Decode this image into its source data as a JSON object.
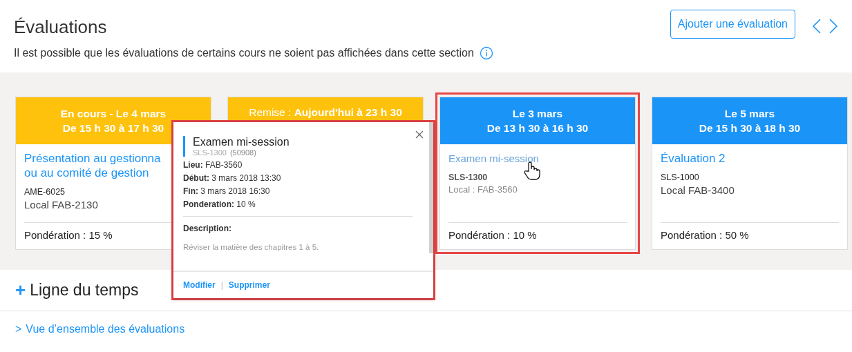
{
  "header": {
    "title": "Évaluations",
    "add_button": "Ajouter une évaluation",
    "note": "Il est possible que les évaluations de certains cours ne soient pas affichées dans cette section"
  },
  "cards": [
    {
      "color": "#fec20c",
      "header_lines": [
        "En cours - Le 4 mars",
        "De 15 h 30 à 17 h 30"
      ],
      "title_lines": [
        "Présentation au gestionna",
        "ou au comité de gestion"
      ],
      "course": "AME-6025",
      "room": "Local FAB-2130",
      "weight": "Pondération : 15 %",
      "highlighted": false,
      "hovered": false
    },
    {
      "color": "#fec20c",
      "header_lines": [
        "Remise : **Aujourd'hui à 23 h 30**"
      ],
      "highlighted": false
    },
    {
      "color": "#1b94f8",
      "header_lines": [
        "Le 3 mars",
        "De 13 h 30 à 16 h 30"
      ],
      "title_lines": [
        "Examen mi-session"
      ],
      "course": "SLS-1300",
      "room": "Local : FAB-3560",
      "weight": "Pondération : 10 %",
      "highlighted": true,
      "hovered": true
    },
    {
      "color": "#1b94f8",
      "header_lines": [
        "Le 5 mars",
        "De 15 h 30 à 18 h 30"
      ],
      "title_lines": [
        "Évaluation 2"
      ],
      "course": "SLS-1000",
      "room": "Local FAB-3400",
      "weight": "Pondération : 50 %",
      "highlighted": false,
      "hovered": false
    }
  ],
  "popup": {
    "highlighted": true,
    "title": "Examen mi-session",
    "course": "SLS-1300",
    "id": "(50908)",
    "fields": [
      {
        "label": "Lieu:",
        "value": "FAB-3560"
      },
      {
        "label": "Début:",
        "value": "3 mars 2018 13:30"
      },
      {
        "label": "Fin:",
        "value": "3 mars 2018 16:30"
      },
      {
        "label": "Ponderation:",
        "value": "10 %"
      }
    ],
    "description_label": "Description:",
    "description": "Réviser la matière des chapitres 1 à 5.",
    "actions": [
      "Modifier",
      "Supprimer"
    ],
    "separator": "|"
  },
  "timeline": {
    "plus": "+",
    "title": "Ligne du temps"
  },
  "overview_link": {
    "chevron": ">",
    "label": "Vue d’ensemble des évaluations"
  }
}
